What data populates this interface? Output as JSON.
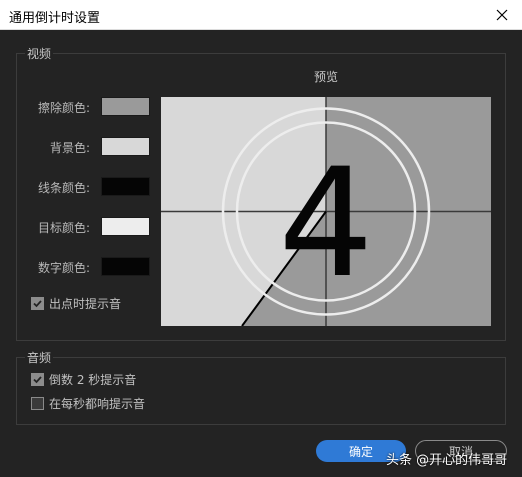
{
  "window": {
    "title": "通用倒计时设置"
  },
  "video_group": {
    "label": "视频",
    "preview_label": "预览",
    "preview_digit": "4",
    "rows": [
      {
        "label": "擦除颜色:",
        "color": "#9a9a9a"
      },
      {
        "label": "背景色:",
        "color": "#d8d8d8"
      },
      {
        "label": "线条颜色:",
        "color": "#050505"
      },
      {
        "label": "目标颜色:",
        "color": "#ededed"
      },
      {
        "label": "数字颜色:",
        "color": "#050505"
      }
    ],
    "cue_checkbox": {
      "label": "出点时提示音",
      "checked": true
    }
  },
  "audio_group": {
    "label": "音频",
    "checkboxes": [
      {
        "label": "倒数 2 秒提示音",
        "checked": true
      },
      {
        "label": "在每秒都响提示音",
        "checked": false
      }
    ]
  },
  "buttons": {
    "ok": "确定",
    "cancel": "取消"
  },
  "watermark": "头条 @开心的伟哥哥"
}
